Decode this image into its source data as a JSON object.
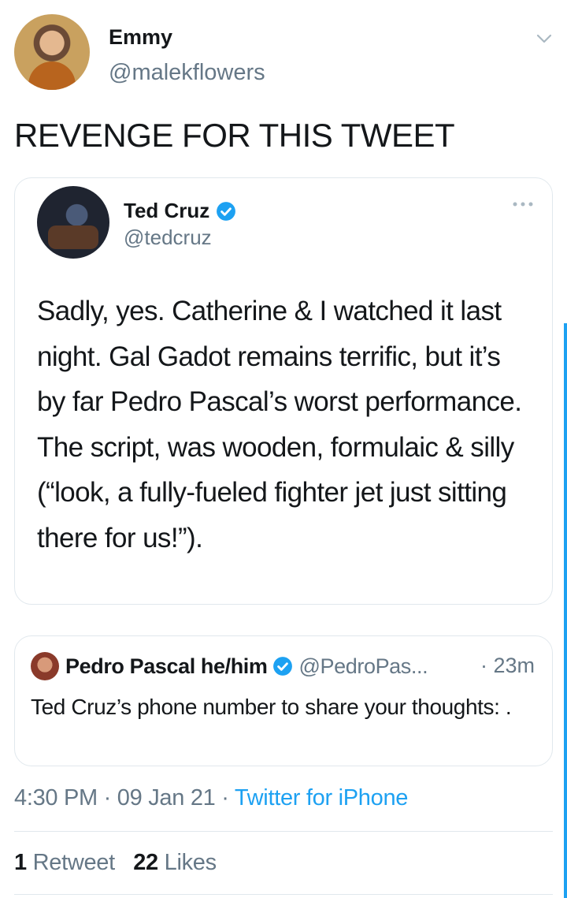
{
  "tweet": {
    "author_name": "Emmy",
    "author_handle": "@malekflowers",
    "text": "REVENGE FOR THIS TWEET"
  },
  "quoted_tweet": {
    "author_name": "Ted Cruz",
    "author_handle": "@tedcruz",
    "text": "Sadly, yes. Catherine & I watched it last night. Gal Gadot remains terrific, but it’s by far Pedro Pascal’s worst performance. The script, was wooden, formulaic & silly (“look, a fully-fueled fighter jet just sitting there for us!”)."
  },
  "reply_tweet": {
    "author_name": "Pedro Pascal he/him",
    "author_handle": "@PedroPas...",
    "time": "· 23m",
    "text": "Ted Cruz’s phone number to share your thoughts: ."
  },
  "meta": {
    "time": "4:30 PM",
    "date": "09 Jan 21",
    "separator": "·",
    "source": "Twitter for iPhone"
  },
  "stats": {
    "retweets_count": "1",
    "retweets_label": "Retweet",
    "likes_count": "22",
    "likes_label": "Likes"
  },
  "colors": {
    "accent": "#1da1f2",
    "secondary_text": "#657786",
    "border": "#e1e8ed"
  }
}
